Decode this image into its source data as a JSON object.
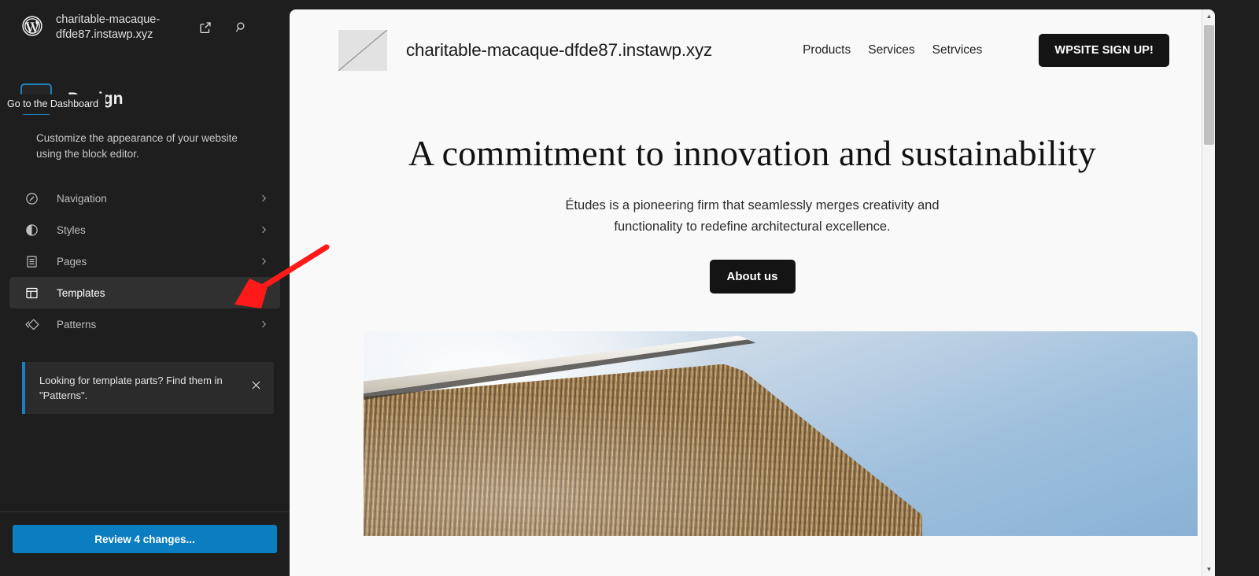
{
  "sidebar": {
    "logo_icon": "wordpress-logo",
    "site_title": "charitable-macaque-dfde87.instawp.xyz",
    "view_site_icon": "external-link-icon",
    "search_icon": "search-icon",
    "back_icon": "chevron-left-icon",
    "back_tooltip": "Go to the Dashboard",
    "heading": "Design",
    "description": "Customize the appearance of your website using the block editor.",
    "items": [
      {
        "label": "Navigation",
        "icon": "navigation-icon",
        "chevron": "chevron-right-icon",
        "active": false
      },
      {
        "label": "Styles",
        "icon": "styles-icon",
        "chevron": "chevron-right-icon",
        "active": false
      },
      {
        "label": "Pages",
        "icon": "pages-icon",
        "chevron": "chevron-right-icon",
        "active": false
      },
      {
        "label": "Templates",
        "icon": "templates-icon",
        "chevron": "chevron-right-icon",
        "active": true
      },
      {
        "label": "Patterns",
        "icon": "patterns-icon",
        "chevron": "chevron-right-icon",
        "active": false
      }
    ],
    "notice": {
      "text": "Looking for template parts? Find them in \"Patterns\".",
      "close_icon": "close-icon",
      "accent_color": "#1d7dc0"
    },
    "footer": {
      "review_label": "Review 4 changes...",
      "button_color": "#0b7ec1"
    }
  },
  "preview": {
    "header": {
      "logo_icon": "broken-image-placeholder-icon",
      "site_name": "charitable-macaque-dfde87.instawp.xyz",
      "nav": [
        "Products",
        "Services",
        "Setrvices"
      ],
      "cta_label": "WPSITE SIGN UP!"
    },
    "hero": {
      "title": "A commitment to innovation and sustainability",
      "subtitle": "Études is a pioneering firm that seamlessly merges creativity and functionality to redefine architectural excellence.",
      "cta_label": "About us",
      "image_alt": "architectural-building-photo"
    },
    "scrollbar": {
      "up_arrow_icon": "triangle-up-icon",
      "down_arrow_icon": "triangle-down-icon"
    }
  },
  "annotation": {
    "arrow_color": "#ff1a1a",
    "points_to": "templates-row-chevron"
  }
}
